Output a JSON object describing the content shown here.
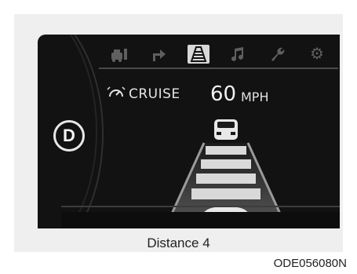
{
  "display": {
    "gear": "D",
    "cruise_label": "CRUISE",
    "speed_value": "60",
    "speed_unit": "MPH",
    "menu_icons": [
      {
        "name": "driving-info-icon",
        "active": false
      },
      {
        "name": "turn-arrow-icon",
        "active": false
      },
      {
        "name": "driving-assist-icon",
        "active": true
      },
      {
        "name": "music-note-icon",
        "active": false
      },
      {
        "name": "wrench-icon",
        "active": false
      },
      {
        "name": "gear-settings-icon",
        "active": false
      }
    ],
    "distance_level": 4,
    "distance_levels_total": 4
  },
  "caption": "Distance 4",
  "figure_code": "ODE056080N",
  "colors": {
    "screen": "#121212",
    "text": "#e4e4e4",
    "icon_inactive": "#5f5f5f",
    "bar": "#d9d9d9"
  }
}
